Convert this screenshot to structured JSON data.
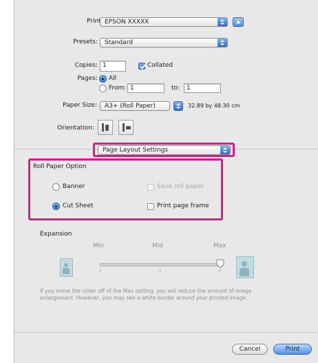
{
  "printer": {
    "label": "Printer:",
    "value": "EPSON XXXXX"
  },
  "presets": {
    "label": "Presets:",
    "value": "Standard"
  },
  "copies": {
    "label": "Copies:",
    "value": "1",
    "collated_label": "Collated",
    "collated_checked": true
  },
  "pages": {
    "label": "Pages:",
    "all_label": "All",
    "from_label": "From:",
    "from_value": "1",
    "to_label": "to:",
    "to_value": "1"
  },
  "paper_size": {
    "label": "Paper Size:",
    "value": "A3+ (Roll Paper)",
    "dimensions": "32.89 by 48.30 cm"
  },
  "orientation": {
    "label": "Orientation:"
  },
  "section_popup": {
    "value": "Page Layout Settings"
  },
  "roll_paper": {
    "title": "Roll Paper Option",
    "banner_label": "Banner",
    "cut_sheet_label": "Cut Sheet",
    "save_roll_label": "Save roll paper",
    "print_frame_label": "Print page frame",
    "selected": "Cut Sheet"
  },
  "expansion": {
    "title": "Expansion",
    "min_label": "Min",
    "mid_label": "Mid",
    "max_label": "Max",
    "level": "Max",
    "note": "If you move the slider off of the Max setting, you will reduce the amount of image enlargement. However, you may see a white border around your printed image."
  },
  "buttons": {
    "cancel": "Cancel",
    "print": "Print"
  },
  "colors": {
    "highlight": "#e0168c",
    "accent": "#2f78dc"
  },
  "icons": [
    "help-icon",
    "portrait-icon",
    "landscape-icon",
    "popup-arrows-icon",
    "image-small-icon",
    "image-large-icon",
    "slider-thumb-icon"
  ]
}
